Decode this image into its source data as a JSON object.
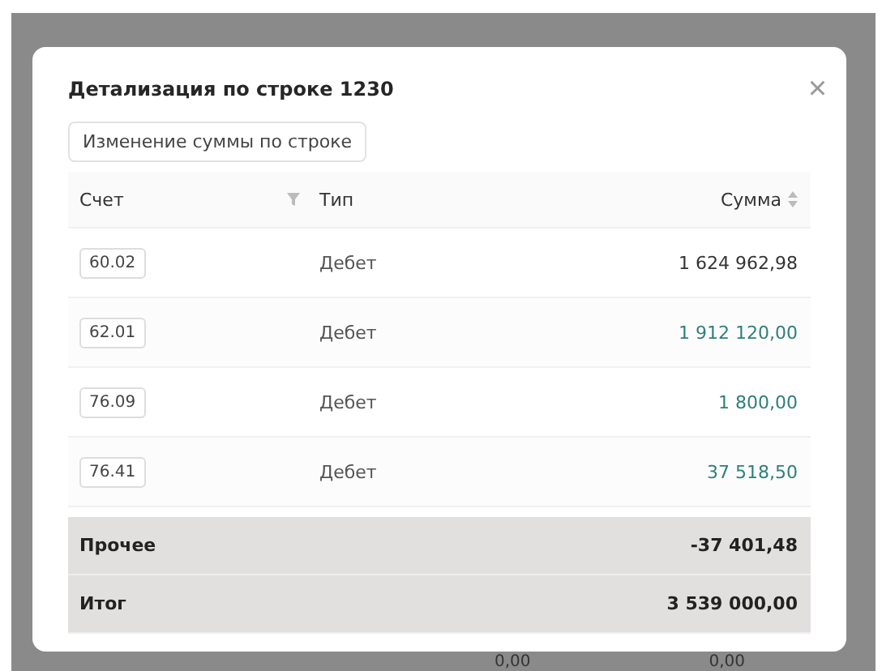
{
  "dialog": {
    "title": "Детализация по строке 1230",
    "close_label": "×",
    "action_button": "Изменение суммы по строке"
  },
  "table": {
    "columns": [
      {
        "label": "Счет",
        "kind": "filter"
      },
      {
        "label": "Тип",
        "kind": "plain"
      },
      {
        "label": "Сумма",
        "kind": "sort"
      }
    ],
    "rows": [
      {
        "account": "60.02",
        "type": "Дебет",
        "amount": "1 624 962,98",
        "color": "#333333"
      },
      {
        "account": "62.01",
        "type": "Дебет",
        "amount": "1 912 120,00",
        "color": "#2f7f7a"
      },
      {
        "account": "76.09",
        "type": "Дебет",
        "amount": "1 800,00",
        "color": "#2f7f7a"
      },
      {
        "account": "76.41",
        "type": "Дебет",
        "amount": "37 518,50",
        "color": "#2f7f7a"
      }
    ],
    "summary": [
      {
        "label": "Прочее",
        "amount": "-37 401,48"
      },
      {
        "label": "Итог",
        "amount": "3 539 000,00"
      }
    ]
  },
  "background": {
    "cells": [
      "0,00",
      "0,00"
    ]
  }
}
